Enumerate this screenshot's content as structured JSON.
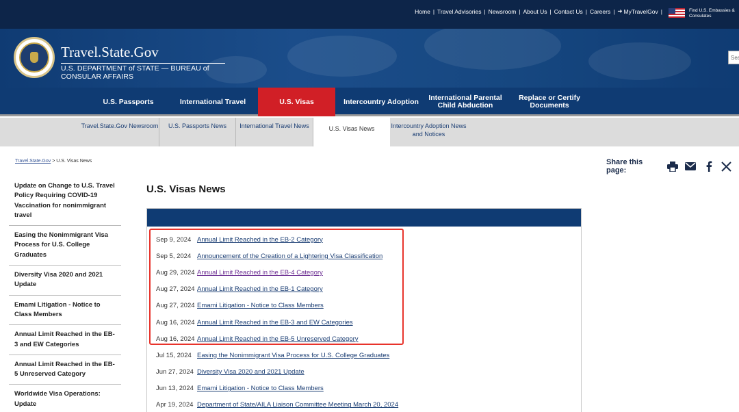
{
  "utility": {
    "links": [
      "Home",
      "Travel Advisories",
      "Newsroom",
      "About Us",
      "Contact Us",
      "Careers",
      "MyTravelGov"
    ],
    "embassy_label": "Find U.S. Embassies & Consulates"
  },
  "banner": {
    "title": "Travel.State.Gov",
    "subtitle": "U.S. DEPARTMENT of STATE — BUREAU of CONSULAR AFFAIRS",
    "search_placeholder": "Sea"
  },
  "mainnav": {
    "items": [
      {
        "label": "U.S. Passports"
      },
      {
        "label": "International Travel"
      },
      {
        "label": "U.S. Visas"
      },
      {
        "label": "Intercountry Adoption"
      },
      {
        "label": "International Parental Child Abduction"
      },
      {
        "label": "Replace or Certify Documents"
      }
    ]
  },
  "subnav": {
    "items": [
      {
        "label": "Travel.State.Gov Newsroom"
      },
      {
        "label": "U.S. Passports News"
      },
      {
        "label": "International Travel News"
      },
      {
        "label": "U.S. Visas News"
      },
      {
        "label": "Intercountry Adoption News and Notices"
      }
    ]
  },
  "breadcrumb": {
    "link": "Travel.State.Gov",
    "separator": " > ",
    "current": "U.S. Visas News"
  },
  "share": {
    "label": "Share this page:",
    "icons": [
      "print-icon",
      "email-icon",
      "facebook-icon",
      "x-icon"
    ]
  },
  "sidebar": {
    "items": [
      {
        "label": "Update on Change to U.S. Travel Policy Requiring COVID-19 Vaccination for nonimmigrant travel"
      },
      {
        "label": "Easing the Nonimmigrant Visa Process for U.S. College Graduates"
      },
      {
        "label": "Diversity Visa 2020 and 2021 Update"
      },
      {
        "label": "Emami Litigation - Notice to Class Members"
      },
      {
        "label": "Annual Limit Reached in the EB-3 and EW Categories"
      },
      {
        "label": "Annual Limit Reached in the EB-5 Unreserved Category"
      },
      {
        "label": "Worldwide Visa Operations: Update"
      }
    ]
  },
  "content": {
    "title": "U.S. Visas News",
    "news": [
      {
        "date": "Sep 9, 2024",
        "title": "Annual Limit Reached in the EB-2 Category"
      },
      {
        "date": "Sep 5, 2024",
        "title": "Announcement of the Creation of a Lightering Visa Classification"
      },
      {
        "date": "Aug 29, 2024",
        "title": "Annual Limit Reached in the EB-4 Category"
      },
      {
        "date": "Aug 27, 2024",
        "title": "Annual Limit Reached in the EB-1 Category"
      },
      {
        "date": "Aug 27, 2024",
        "title": "Emami Litigation - Notice to Class Members"
      },
      {
        "date": "Aug 16, 2024",
        "title": "Annual Limit Reached in the EB-3 and EW Categories"
      },
      {
        "date": "Aug 16, 2024",
        "title": "Annual Limit Reached in the EB-5 Unreserved Category"
      },
      {
        "date": "Jul 15, 2024",
        "title": "Easing the Nonimmigrant Visa Process for U.S. College Graduates"
      },
      {
        "date": "Jun 27, 2024",
        "title": "Diversity Visa 2020 and 2021 Update"
      },
      {
        "date": "Jun 13, 2024",
        "title": "Emami Litigation - Notice to Class Members"
      },
      {
        "date": "Apr 19, 2024",
        "title": "Department of State/AILA Liaison Committee Meeting March 20, 2024"
      }
    ]
  },
  "colors": {
    "navy": "#0f3b73",
    "active_red": "#d11f26",
    "highlight": "#e8332b",
    "link": "#1a3d73",
    "visited": "#6a2c91"
  }
}
